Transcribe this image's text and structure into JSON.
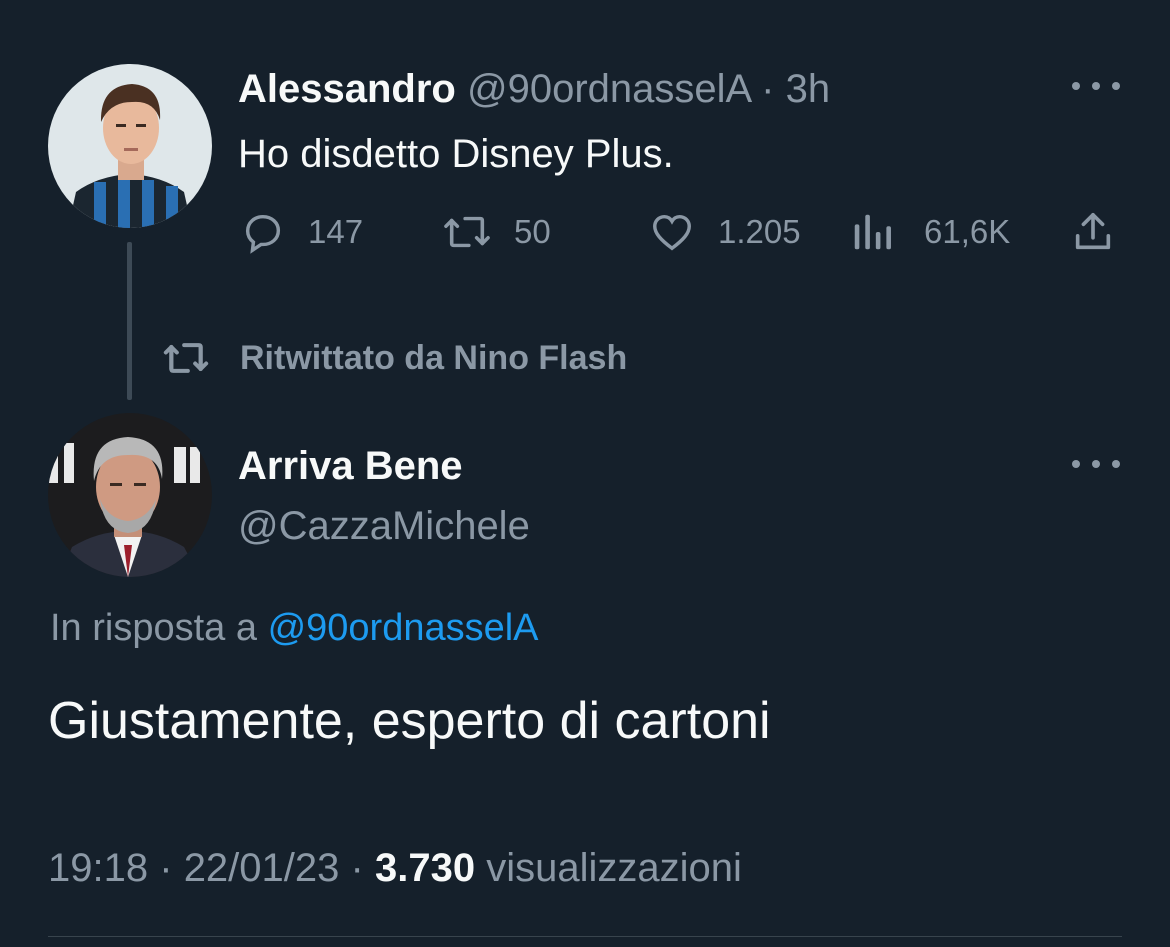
{
  "tweet1": {
    "author_name": "Alessandro",
    "handle": "@90ordnasselA",
    "separator": "·",
    "time": "3h",
    "text": "Ho disdetto Disney Plus.",
    "actions": {
      "replies": "147",
      "retweets": "50",
      "likes": "1.205",
      "views": "61,6K"
    },
    "icons": [
      "reply-icon",
      "retweet-icon",
      "like-icon",
      "views-icon",
      "share-icon",
      "more-icon"
    ]
  },
  "retweet_banner": {
    "text": "Ritwittato da Nino Flash",
    "icon": "retweet-icon"
  },
  "tweet2": {
    "author_name": "Arriva Bene",
    "handle": "@CazzaMichele",
    "reply_prefix": "In risposta a",
    "reply_handle": "@90ordnasselA",
    "text": "Giustamente, esperto di cartoni",
    "time": "19:18",
    "sep1": "·",
    "date": "22/01/23",
    "sep2": "·",
    "views_count": "3.730",
    "views_label": "visualizzazioni"
  },
  "colors": {
    "background": "#15202b",
    "text": "#f7f9f9",
    "muted": "#8b98a5",
    "link": "#1d9bf0",
    "divider": "#38444d"
  }
}
